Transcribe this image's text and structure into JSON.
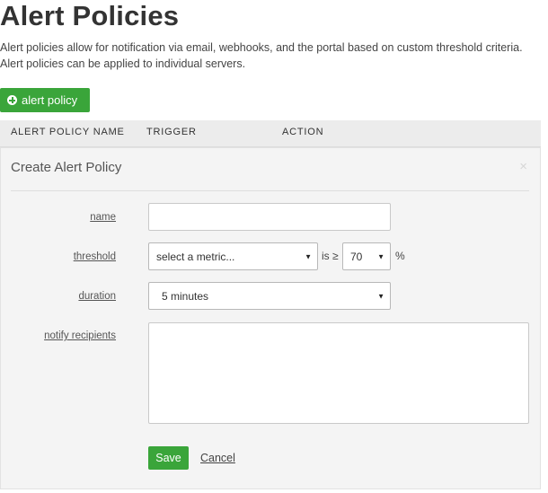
{
  "page": {
    "title": "Alert Policies",
    "description_line1": "Alert policies allow for notification via email, webhooks, and the portal based on custom threshold criteria.",
    "description_line2": "Alert policies can be applied to individual servers.",
    "add_button_label": "alert policy"
  },
  "table": {
    "columns": [
      "ALERT POLICY NAME",
      "TRIGGER",
      "ACTION"
    ]
  },
  "form": {
    "title": "Create Alert Policy",
    "close_glyph": "×",
    "fields": {
      "name": {
        "label": "name",
        "value": ""
      },
      "threshold": {
        "label": "threshold",
        "metric_selected": "select a metric...",
        "operator_text": "is ≥",
        "value_selected": "70",
        "unit": "%"
      },
      "duration": {
        "label": "duration",
        "selected": "5 minutes"
      },
      "notify": {
        "label": "notify recipients",
        "value": ""
      }
    },
    "save_label": "Save",
    "cancel_label": "Cancel"
  },
  "icons": {
    "add": "plus-circle-icon",
    "close": "close-icon",
    "dropdown": "caret-down-icon"
  },
  "colors": {
    "accent_green": "#3aa53a",
    "header_gray": "#ececec",
    "panel_bg": "#f4f4f4"
  }
}
